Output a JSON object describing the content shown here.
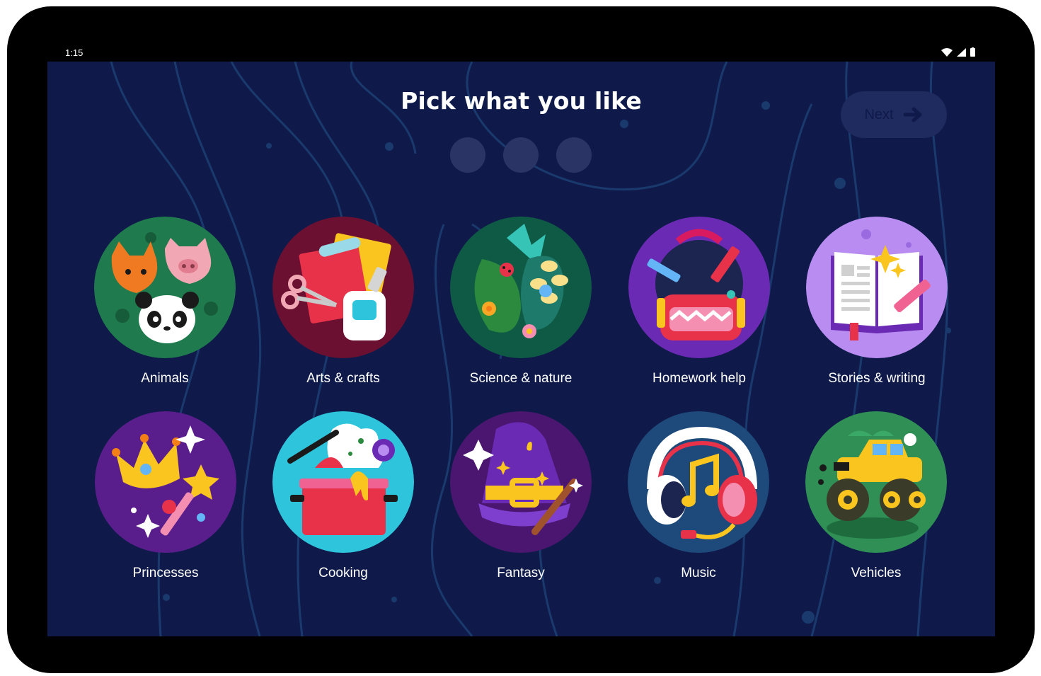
{
  "status_bar": {
    "time": "1:15",
    "icons": [
      "wifi-icon",
      "cell-signal-icon",
      "battery-icon"
    ]
  },
  "header": {
    "title": "Pick what you like",
    "progress_dots": 3
  },
  "next_button": {
    "label": "Next",
    "icon": "arrow-right-icon",
    "enabled": false
  },
  "colors": {
    "background": "#0f1a4a",
    "frame": "#000000",
    "dot": "#2a3566",
    "button": "#1f2a5e"
  },
  "topics": [
    {
      "label": "Animals",
      "icon": "animals-illustration-icon",
      "color": "#1f7a4d"
    },
    {
      "label": "Arts & crafts",
      "icon": "arts-crafts-illustration-icon",
      "color": "#6b1030"
    },
    {
      "label": "Science & nature",
      "icon": "science-nature-illustration-icon",
      "color": "#0f5a45"
    },
    {
      "label": "Homework help",
      "icon": "homework-backpack-illustration-icon",
      "color": "#6a2ab3"
    },
    {
      "label": "Stories & writing",
      "icon": "stories-book-illustration-icon",
      "color": "#b88cf0"
    },
    {
      "label": "Princesses",
      "icon": "princess-crown-illustration-icon",
      "color": "#5a1e8c"
    },
    {
      "label": "Cooking",
      "icon": "cooking-pot-illustration-icon",
      "color": "#2ec4dc"
    },
    {
      "label": "Fantasy",
      "icon": "wizard-hat-illustration-icon",
      "color": "#4a1670"
    },
    {
      "label": "Music",
      "icon": "headphones-illustration-icon",
      "color": "#1d4a7a"
    },
    {
      "label": "Vehicles",
      "icon": "monster-truck-illustration-icon",
      "color": "#2f8f55"
    }
  ]
}
